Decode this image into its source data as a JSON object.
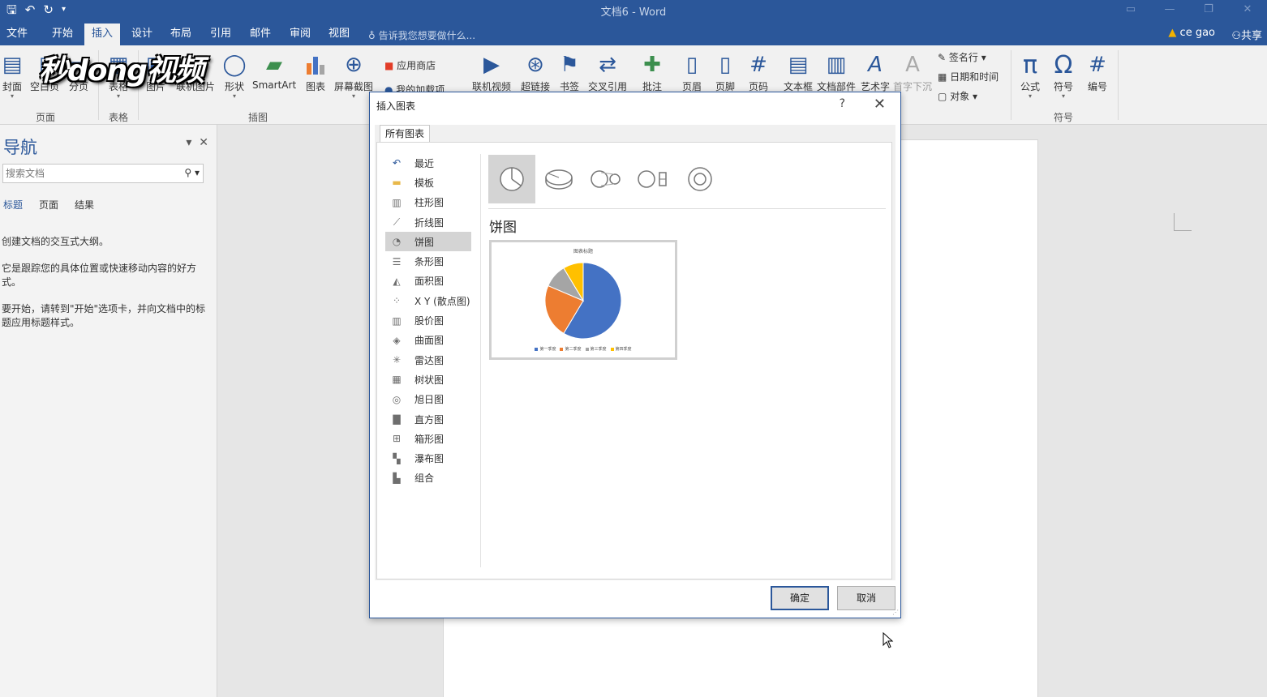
{
  "window": {
    "title": "文档6 - Word",
    "user": "ce gao",
    "share": "共享",
    "tell_me": "告诉我您想要做什么..."
  },
  "tabs": [
    "文件",
    "开始",
    "插入",
    "设计",
    "布局",
    "引用",
    "邮件",
    "审阅",
    "视图"
  ],
  "active_tab": "插入",
  "ribbon": {
    "buttons": {
      "cover": "封面",
      "blank": "空白页",
      "break": "分页",
      "table": "表格",
      "picture": "图片",
      "online_picture": "联机图片",
      "shapes": "形状",
      "smartart": "SmartArt",
      "chart": "图表",
      "screenshot": "屏幕截图",
      "store": "应用商店",
      "myaddins": "我的加载项",
      "online_video": "联机视频",
      "hyperlink": "超链接",
      "bookmark": "书签",
      "crossref": "交叉引用",
      "comment": "批注",
      "header": "页眉",
      "footer": "页脚",
      "pagenum": "页码",
      "textbox": "文本框",
      "quickparts": "文档部件",
      "wordart": "艺术字",
      "dropcap": "首字下沉",
      "signature": "签名行",
      "datetime": "日期和时间",
      "object": "对象",
      "equation": "公式",
      "symbol": "符号",
      "number": "编号"
    },
    "groups": {
      "pages": "页面",
      "tables": "表格",
      "illustrations": "插图",
      "symbols": "符号"
    }
  },
  "watermark_logo": "秒dong视频",
  "nav": {
    "title": "导航",
    "search_placeholder": "搜索文档",
    "tabs": [
      "标题",
      "页面",
      "结果"
    ],
    "text1": "创建文档的交互式大纲。",
    "text2": "它是跟踪您的具体位置或快速移动内容的好方式。",
    "text3": "要开始，请转到\"开始\"选项卡，并向文档中的标题应用标题样式。"
  },
  "dialog": {
    "title": "插入图表",
    "help": "?",
    "tab": "所有图表",
    "chart_types": [
      {
        "label": "最近",
        "icon": "recent-icon"
      },
      {
        "label": "模板",
        "icon": "folder-icon"
      },
      {
        "label": "柱形图",
        "icon": "column-chart-icon"
      },
      {
        "label": "折线图",
        "icon": "line-chart-icon"
      },
      {
        "label": "饼图",
        "icon": "pie-chart-icon"
      },
      {
        "label": "条形图",
        "icon": "bar-chart-icon"
      },
      {
        "label": "面积图",
        "icon": "area-chart-icon"
      },
      {
        "label": "X Y (散点图)",
        "icon": "scatter-chart-icon"
      },
      {
        "label": "股价图",
        "icon": "stock-chart-icon"
      },
      {
        "label": "曲面图",
        "icon": "surface-chart-icon"
      },
      {
        "label": "雷达图",
        "icon": "radar-chart-icon"
      },
      {
        "label": "树状图",
        "icon": "treemap-chart-icon"
      },
      {
        "label": "旭日图",
        "icon": "sunburst-chart-icon"
      },
      {
        "label": "直方图",
        "icon": "histogram-chart-icon"
      },
      {
        "label": "箱形图",
        "icon": "boxwhisker-chart-icon"
      },
      {
        "label": "瀑布图",
        "icon": "waterfall-chart-icon"
      },
      {
        "label": "组合",
        "icon": "combo-chart-icon"
      }
    ],
    "selected_type": "饼图",
    "heading": "饼图",
    "preview_title": "图表标题",
    "preview_slices": [
      {
        "label": "第一季度",
        "value": 8.2,
        "color": "#4472c4"
      },
      {
        "label": "第二季度",
        "value": 3.2,
        "color": "#ed7d31"
      },
      {
        "label": "第三季度",
        "value": 1.4,
        "color": "#a5a5a5"
      },
      {
        "label": "第四季度",
        "value": 1.2,
        "color": "#ffc000"
      }
    ],
    "ok": "确定",
    "cancel": "取消"
  },
  "colors": {
    "accent": "#2b579a",
    "selection": "#d4d4d4"
  }
}
